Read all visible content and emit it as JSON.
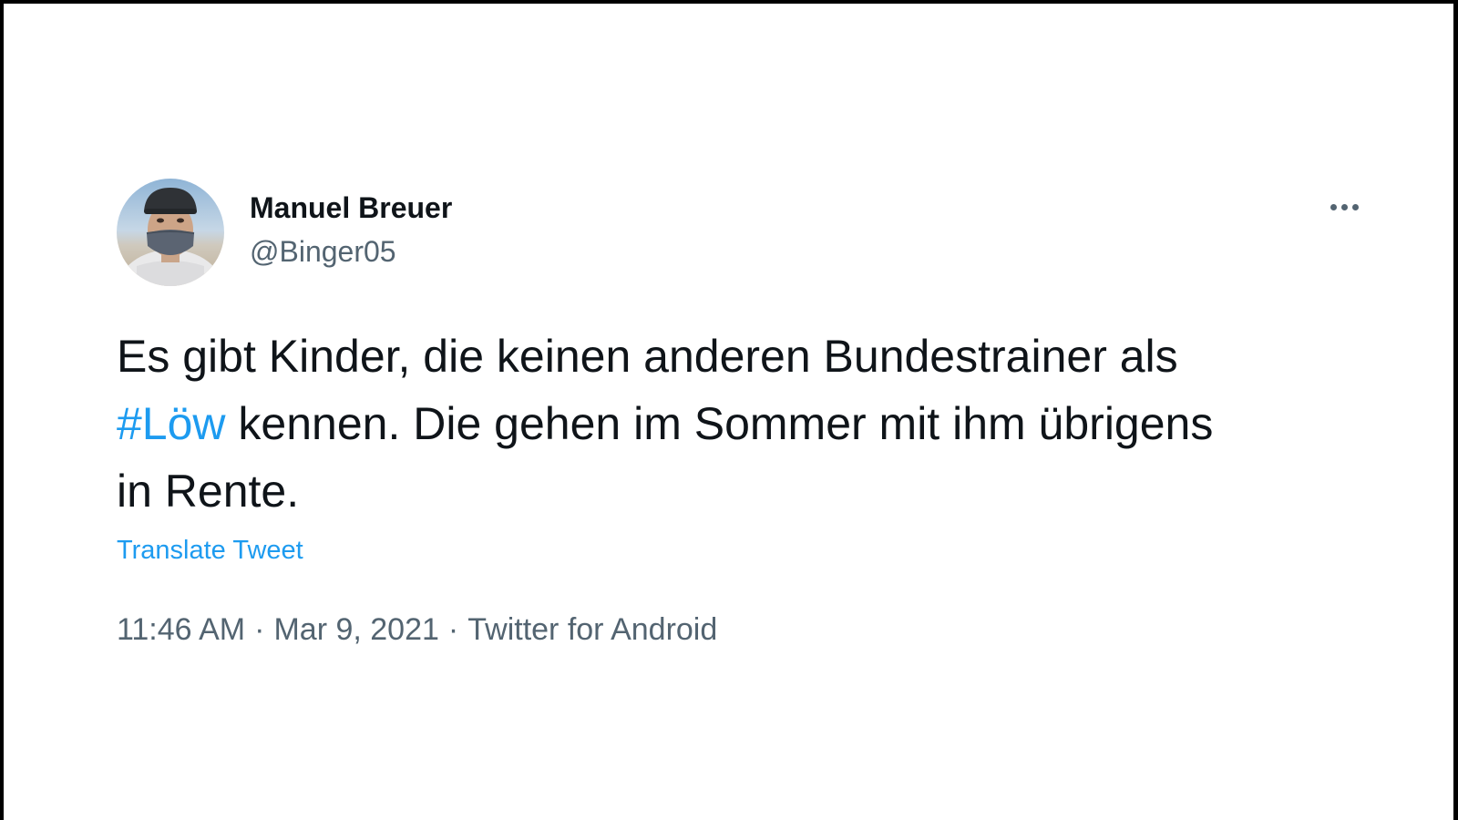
{
  "tweet": {
    "author": {
      "display_name": "Manuel Breuer",
      "handle": "@Binger05"
    },
    "text": {
      "line1": "Es gibt Kinder, die keinen anderen Bundestrainer als",
      "hashtag": "#Löw",
      "line2_rest": " kennen. Die gehen im Sommer mit ihm übrigens",
      "line3": "in Rente."
    },
    "translate_label": "Translate Tweet",
    "time": "11:46 AM",
    "date": "Mar 9, 2021",
    "source": "Twitter for Android",
    "separator": "·"
  },
  "icons": {
    "more": "more-options-icon"
  },
  "colors": {
    "link": "#1d9bf0",
    "muted": "#536471",
    "text": "#0f1419"
  }
}
